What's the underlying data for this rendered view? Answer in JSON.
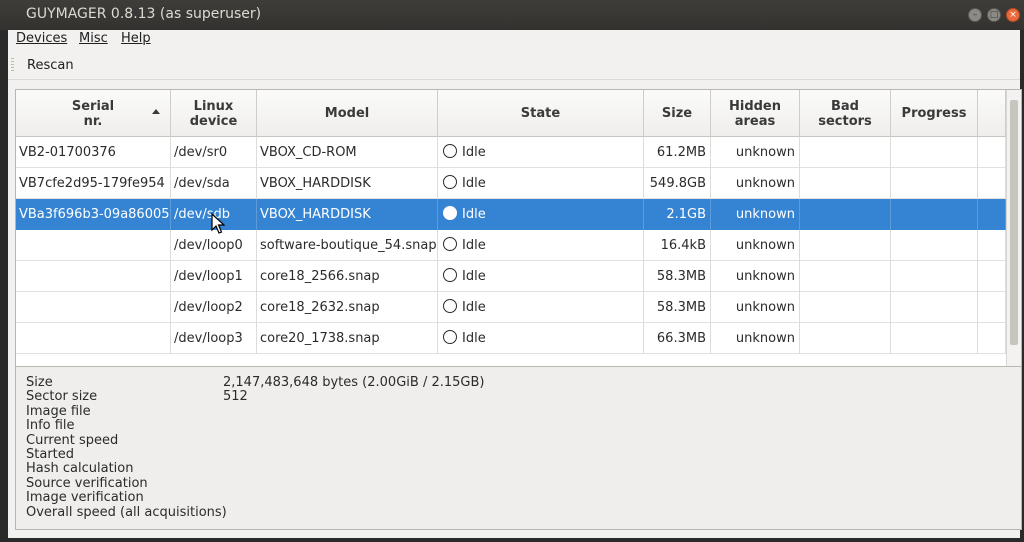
{
  "window": {
    "title": "GUYMAGER 0.8.13 (as superuser)"
  },
  "menu": {
    "devices": "Devices",
    "misc": "Misc",
    "help": "Help"
  },
  "toolbar": {
    "rescan": "Rescan"
  },
  "table": {
    "columns": {
      "serial": "Serial\nnr.",
      "linux_device": "Linux\ndevice",
      "model": "Model",
      "state": "State",
      "size": "Size",
      "hidden_areas": "Hidden\nareas",
      "bad_sectors": "Bad\nsectors",
      "progress": "Progress"
    },
    "sort": {
      "column": "serial",
      "order": "ascending"
    },
    "selected_row": 2,
    "rows": [
      {
        "serial": "VB2-01700376",
        "device": "/dev/sr0",
        "model": "VBOX_CD-ROM",
        "state": "Idle",
        "size": "61.2MB",
        "hidden": "unknown",
        "bad": "",
        "progress": ""
      },
      {
        "serial": "VB7cfe2d95-179fe954",
        "device": "/dev/sda",
        "model": "VBOX_HARDDISK",
        "state": "Idle",
        "size": "549.8GB",
        "hidden": "unknown",
        "bad": "",
        "progress": ""
      },
      {
        "serial": "VBa3f696b3-09a86005",
        "device": "/dev/sdb",
        "model": "VBOX_HARDDISK",
        "state": "Idle",
        "size": "2.1GB",
        "hidden": "unknown",
        "bad": "",
        "progress": ""
      },
      {
        "serial": "",
        "device": "/dev/loop0",
        "model": "software-boutique_54.snap",
        "state": "Idle",
        "size": "16.4kB",
        "hidden": "unknown",
        "bad": "",
        "progress": ""
      },
      {
        "serial": "",
        "device": "/dev/loop1",
        "model": "core18_2566.snap",
        "state": "Idle",
        "size": "58.3MB",
        "hidden": "unknown",
        "bad": "",
        "progress": ""
      },
      {
        "serial": "",
        "device": "/dev/loop2",
        "model": "core18_2632.snap",
        "state": "Idle",
        "size": "58.3MB",
        "hidden": "unknown",
        "bad": "",
        "progress": ""
      },
      {
        "serial": "",
        "device": "/dev/loop3",
        "model": "core20_1738.snap",
        "state": "Idle",
        "size": "66.3MB",
        "hidden": "unknown",
        "bad": "",
        "progress": ""
      }
    ]
  },
  "details": {
    "size_label": "Size",
    "size_value": "2,147,483,648 bytes (2.00GiB / 2.15GB)",
    "sector_size_label": "Sector size",
    "sector_size_value": "512",
    "image_file_label": "Image file",
    "info_file_label": "Info file",
    "current_speed_label": "Current speed",
    "started_label": "Started",
    "hash_calc_label": "Hash calculation",
    "source_verif_label": "Source verification",
    "image_verif_label": "Image verification",
    "overall_speed_label": "Overall speed (all acquisitions)"
  },
  "icons": {
    "state": "circle-icon",
    "sort": "sort-ascending-icon",
    "cursor": "mouse-pointer-icon"
  },
  "colors": {
    "selection": "#3584d4",
    "close_button": "#e96a3c"
  }
}
